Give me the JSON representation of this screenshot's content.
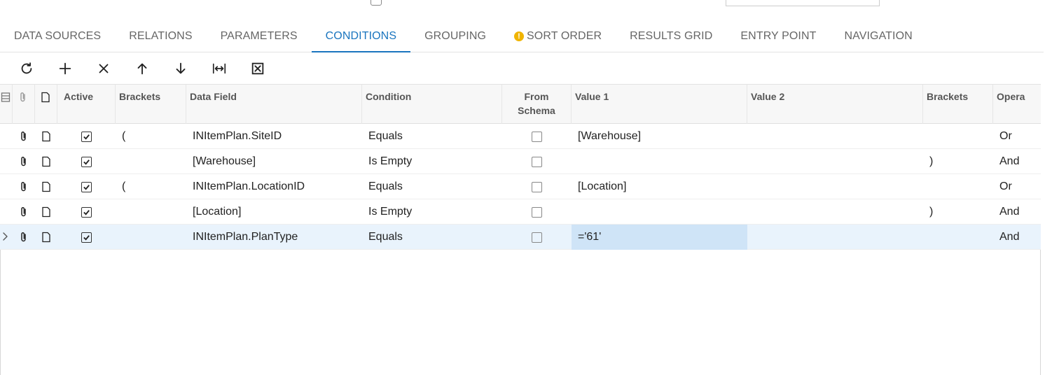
{
  "tabs": [
    {
      "label": "DATA SOURCES",
      "active": false
    },
    {
      "label": "RELATIONS",
      "active": false
    },
    {
      "label": "PARAMETERS",
      "active": false
    },
    {
      "label": "CONDITIONS",
      "active": true
    },
    {
      "label": "GROUPING",
      "active": false
    },
    {
      "label": "SORT ORDER",
      "active": false,
      "warning": true
    },
    {
      "label": "RESULTS GRID",
      "active": false
    },
    {
      "label": "ENTRY POINT",
      "active": false
    },
    {
      "label": "NAVIGATION",
      "active": false
    }
  ],
  "toolbar": {
    "icons": [
      "refresh-icon",
      "plus-icon",
      "close-icon",
      "arrow-up-icon",
      "arrow-down-icon",
      "fit-columns-icon",
      "excel-export-icon"
    ]
  },
  "columns": {
    "active": "Active",
    "brackets_open": "Brackets",
    "data_field": "Data Field",
    "condition": "Condition",
    "from_schema_1": "From",
    "from_schema_2": "Schema",
    "value1": "Value 1",
    "value2": "Value 2",
    "brackets_close": "Brackets",
    "operator": "Opera"
  },
  "rows": [
    {
      "active": true,
      "open_bracket": "(",
      "data_field": "INItemPlan.SiteID",
      "condition": "Equals",
      "from_schema": false,
      "value1": "[Warehouse]",
      "value2": "",
      "close_bracket": "",
      "operator": "Or"
    },
    {
      "active": true,
      "open_bracket": "",
      "data_field": "[Warehouse]",
      "condition": "Is Empty",
      "from_schema": false,
      "value1": "",
      "value2": "",
      "close_bracket": ")",
      "operator": "And"
    },
    {
      "active": true,
      "open_bracket": "(",
      "data_field": "INItemPlan.LocationID",
      "condition": "Equals",
      "from_schema": false,
      "value1": "[Location]",
      "value2": "",
      "close_bracket": "",
      "operator": "Or"
    },
    {
      "active": true,
      "open_bracket": "",
      "data_field": "[Location]",
      "condition": "Is Empty",
      "from_schema": false,
      "value1": "",
      "value2": "",
      "close_bracket": ")",
      "operator": "And"
    },
    {
      "active": true,
      "open_bracket": "",
      "data_field": "INItemPlan.PlanType",
      "condition": "Equals",
      "from_schema": false,
      "value1": "='61'",
      "value2": "",
      "close_bracket": "",
      "operator": "And",
      "selected": true
    }
  ],
  "colors": {
    "accent": "#1a75bf",
    "warning": "#f0b400",
    "selected_row": "#e9f3fc",
    "selected_cell": "#cfe4f7"
  }
}
